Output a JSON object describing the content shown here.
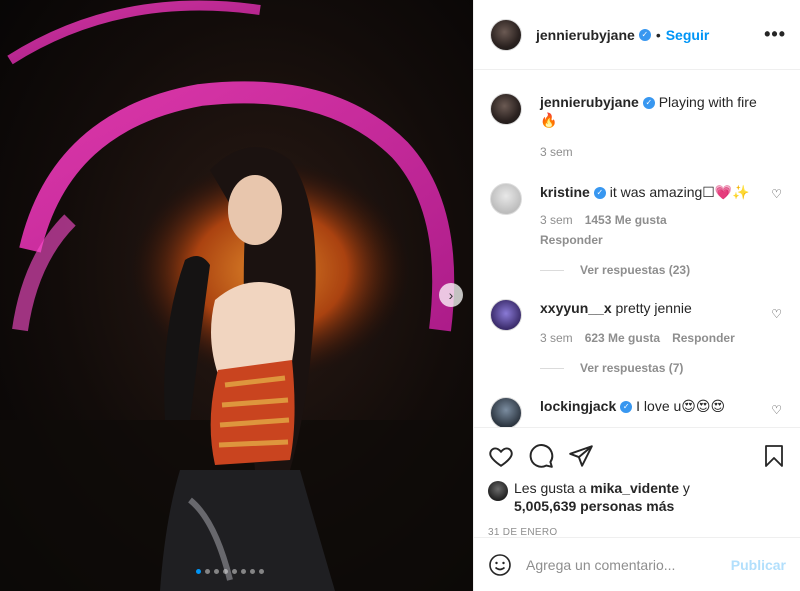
{
  "post": {
    "username": "jennierubyjane",
    "follow_label": "Seguir",
    "separator": "•",
    "more_label": "•••",
    "caption": "Playing with fire",
    "caption_emoji": "🔥",
    "caption_time": "3 sem",
    "carousel_next": "›",
    "carousel_count": 8,
    "carousel_active": 0
  },
  "comments": [
    {
      "username": "kristine",
      "verified": true,
      "text": "it was amazing☐💗✨",
      "time": "3 sem",
      "likes": "1453 Me gusta",
      "reply": "Responder",
      "view_replies": "Ver respuestas (23)"
    },
    {
      "username": "xxyyun__x",
      "verified": false,
      "text": "pretty jennie",
      "time": "3 sem",
      "likes": "623 Me gusta",
      "reply": "Responder",
      "view_replies": "Ver respuestas (7)"
    },
    {
      "username": "lockingjack",
      "verified": true,
      "text": "I love u😍😍😍"
    }
  ],
  "likes": {
    "prefix": "Les gusta a ",
    "user": "mika_vidente",
    "connector": " y",
    "count": "5,005,639 personas más"
  },
  "date": "31 DE ENERO",
  "comment_box": {
    "placeholder": "Agrega un comentario...",
    "publish_label": "Publicar"
  },
  "colors": {
    "accent": "#0095f6",
    "verified": "#3897f0",
    "publish_disabled": "#b2dffc",
    "muted": "#8e8e8e"
  }
}
